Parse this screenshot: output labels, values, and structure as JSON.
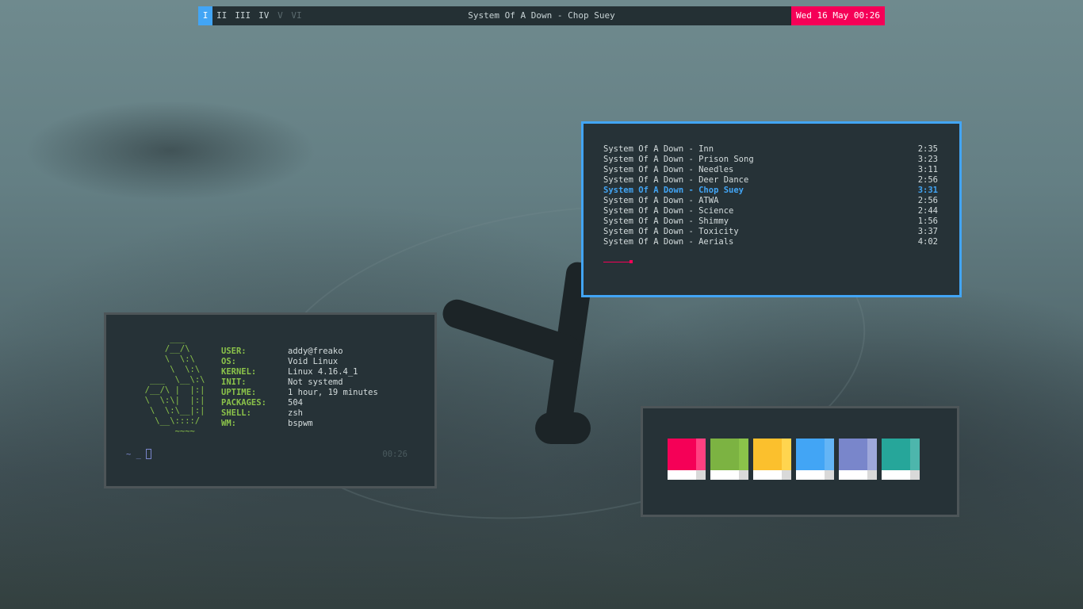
{
  "topbar": {
    "workspaces": [
      {
        "label": "I",
        "state": "active"
      },
      {
        "label": "II",
        "state": "occupied"
      },
      {
        "label": "III",
        "state": "occupied"
      },
      {
        "label": "IV",
        "state": "occupied"
      },
      {
        "label": "V",
        "state": "empty"
      },
      {
        "label": "VI",
        "state": "empty"
      }
    ],
    "title": "System Of A Down - Chop Suey",
    "clock": "Wed 16 May 00:26"
  },
  "playlist": {
    "tracks": [
      {
        "name": "System Of A Down - Inn",
        "duration": "2:35",
        "current": false
      },
      {
        "name": "System Of A Down - Prison Song",
        "duration": "3:23",
        "current": false
      },
      {
        "name": "System Of A Down - Needles",
        "duration": "3:11",
        "current": false
      },
      {
        "name": "System Of A Down - Deer Dance",
        "duration": "2:56",
        "current": false
      },
      {
        "name": "System Of A Down - Chop Suey",
        "duration": "3:31",
        "current": true
      },
      {
        "name": "System Of A Down - ATWA",
        "duration": "2:56",
        "current": false
      },
      {
        "name": "System Of A Down - Science",
        "duration": "2:44",
        "current": false
      },
      {
        "name": "System Of A Down - Shimmy",
        "duration": "1:56",
        "current": false
      },
      {
        "name": "System Of A Down - Toxicity",
        "duration": "3:37",
        "current": false
      },
      {
        "name": "System Of A Down - Aerials",
        "duration": "4:02",
        "current": false
      }
    ]
  },
  "fetch": {
    "logo": "       ___\n      /__/\\\n      \\  \\:\\\n       \\  \\:\\\n   ___  \\__\\:\\\n  /__/\\ |  |:|\n  \\  \\:\\|  |:|\n   \\  \\:\\__|:|\n    \\__\\::::/\n        ~~~~",
    "rows": [
      {
        "key": "USER:",
        "value": "addy@freako"
      },
      {
        "key": "OS:",
        "value": "Void Linux"
      },
      {
        "key": "KERNEL:",
        "value": "Linux 4.16.4_1"
      },
      {
        "key": "INIT:",
        "value": "Not systemd"
      },
      {
        "key": "UPTIME:",
        "value": "1 hour, 19 minutes"
      },
      {
        "key": "PACKAGES:",
        "value": "504"
      },
      {
        "key": "SHELL:",
        "value": "zsh"
      },
      {
        "key": "WM:",
        "value": "bspwm"
      }
    ],
    "prompt": "~ _",
    "clock": "00:26"
  },
  "palette": {
    "colors": [
      {
        "main": "#f50057",
        "bright": "#ff4081"
      },
      {
        "main": "#7cb342",
        "bright": "#8bc34a"
      },
      {
        "main": "#fbc02d",
        "bright": "#ffd54f"
      },
      {
        "main": "#42a5f5",
        "bright": "#64b5f6"
      },
      {
        "main": "#7986cb",
        "bright": "#9fa8da"
      },
      {
        "main": "#26a69a",
        "bright": "#4db6ac"
      }
    ]
  },
  "accent_colors": {
    "focus_border": "#42a5f5",
    "clock_bg": "#f50057",
    "fetch_green": "#8bc34a"
  }
}
